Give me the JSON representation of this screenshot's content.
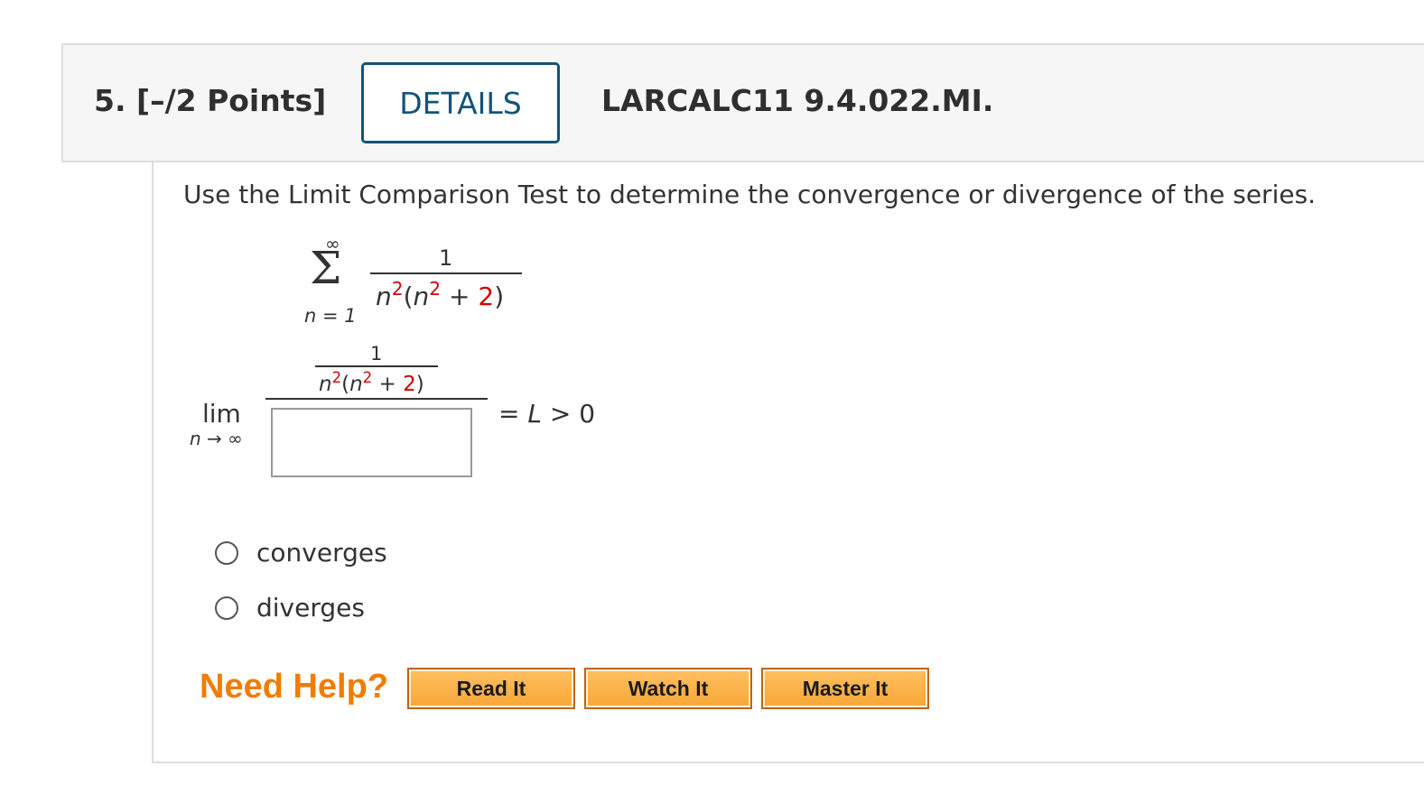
{
  "question": {
    "number_points": "5.  [–/2 Points]",
    "details_label": "DETAILS",
    "problem_id": "LARCALC11 9.4.022.MI."
  },
  "prompt": "Use the Limit Comparison Test to determine the convergence or divergence of the series.",
  "series": {
    "sum_symbol": "Σ",
    "upper": "∞",
    "lower": "n = 1",
    "numerator": "1",
    "denom_base": "n",
    "denom_exp": "2",
    "denom_open": "(",
    "denom_inner_base": "n",
    "denom_inner_exp": "2",
    "denom_plus": " + ",
    "denom_const": "2",
    "denom_close": ")"
  },
  "limit": {
    "lim": "lim",
    "under": "n → ∞",
    "inner_numerator": "1",
    "equals": "= ",
    "L": "L",
    "rest": " > 0",
    "answer_value": ""
  },
  "options": [
    {
      "label": "converges",
      "selected": false
    },
    {
      "label": "diverges",
      "selected": false
    }
  ],
  "help": {
    "title": "Need Help?",
    "buttons": [
      "Read It",
      "Watch It",
      "Master It"
    ]
  },
  "colors": {
    "details_border": "#14537a",
    "highlight_red": "#d40000",
    "need_help_orange": "#f07d00",
    "help_button": "#f7a635"
  }
}
